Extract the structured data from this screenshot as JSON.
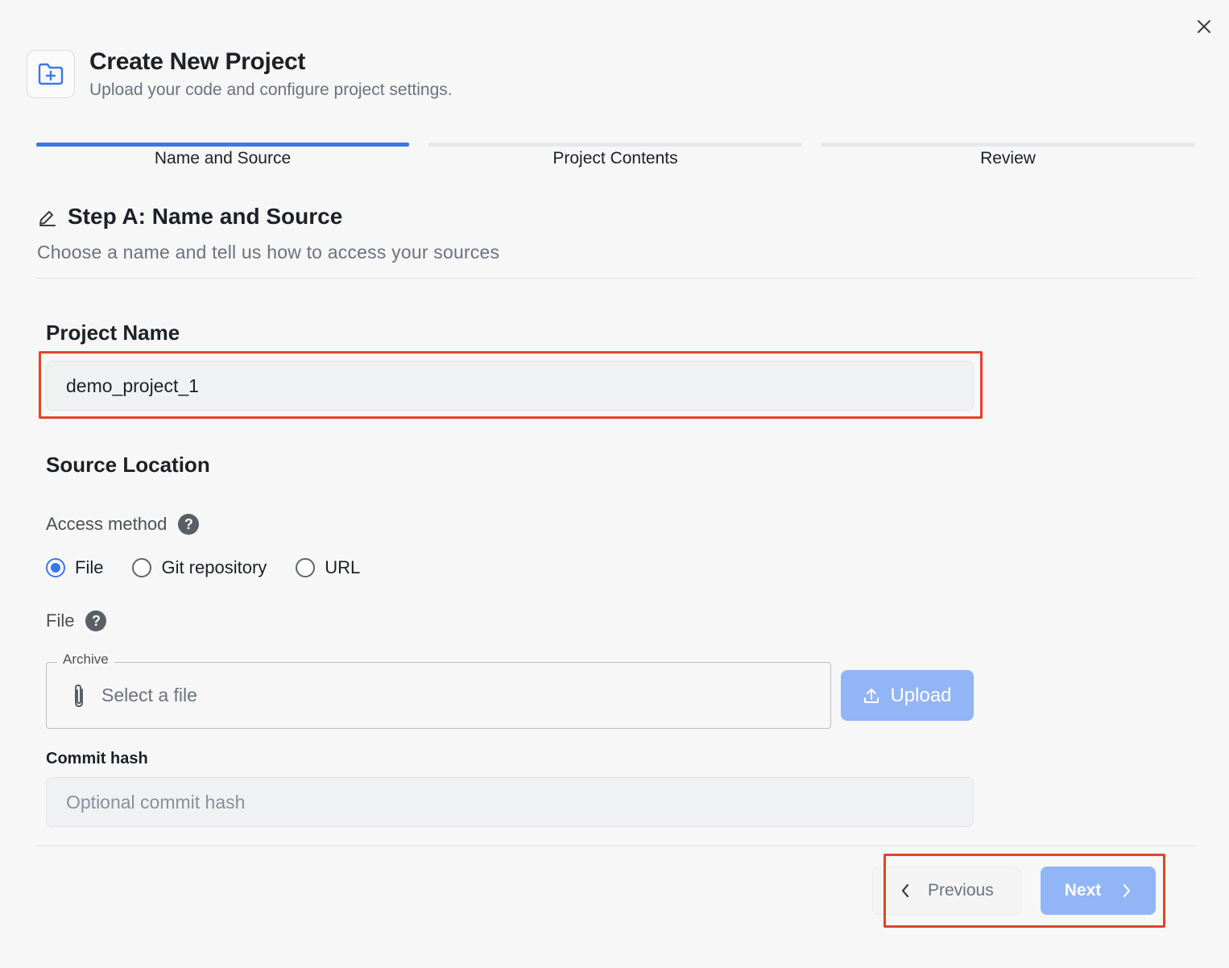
{
  "header": {
    "title": "Create New Project",
    "subtitle": "Upload your code and configure project settings."
  },
  "stepper": {
    "steps": [
      {
        "label": "Name and Source",
        "active": true
      },
      {
        "label": "Project Contents",
        "active": false
      },
      {
        "label": "Review",
        "active": false
      }
    ]
  },
  "section": {
    "title": "Step A: Name and Source",
    "description": "Choose a name and tell us how to access your sources"
  },
  "project_name": {
    "label": "Project Name",
    "value": "demo_project_1"
  },
  "source_location": {
    "title": "Source Location",
    "access_method_label": "Access method",
    "options": [
      {
        "label": "File",
        "checked": true
      },
      {
        "label": "Git repository",
        "checked": false
      },
      {
        "label": "URL",
        "checked": false
      }
    ],
    "file_label": "File",
    "archive_legend": "Archive",
    "archive_placeholder": "Select a file",
    "upload_label": "Upload",
    "commit_label": "Commit hash",
    "commit_placeholder": "Optional commit hash"
  },
  "footer": {
    "previous_label": "Previous",
    "next_label": "Next"
  },
  "colors": {
    "accent": "#3b78e7",
    "accent_disabled": "#91b5f7",
    "highlight": "#e0452b"
  },
  "icons": [
    "folder-plus-icon",
    "close-icon",
    "pencil-icon",
    "help-icon",
    "paperclip-icon",
    "upload-icon",
    "chevron-left-icon",
    "chevron-right-icon"
  ]
}
